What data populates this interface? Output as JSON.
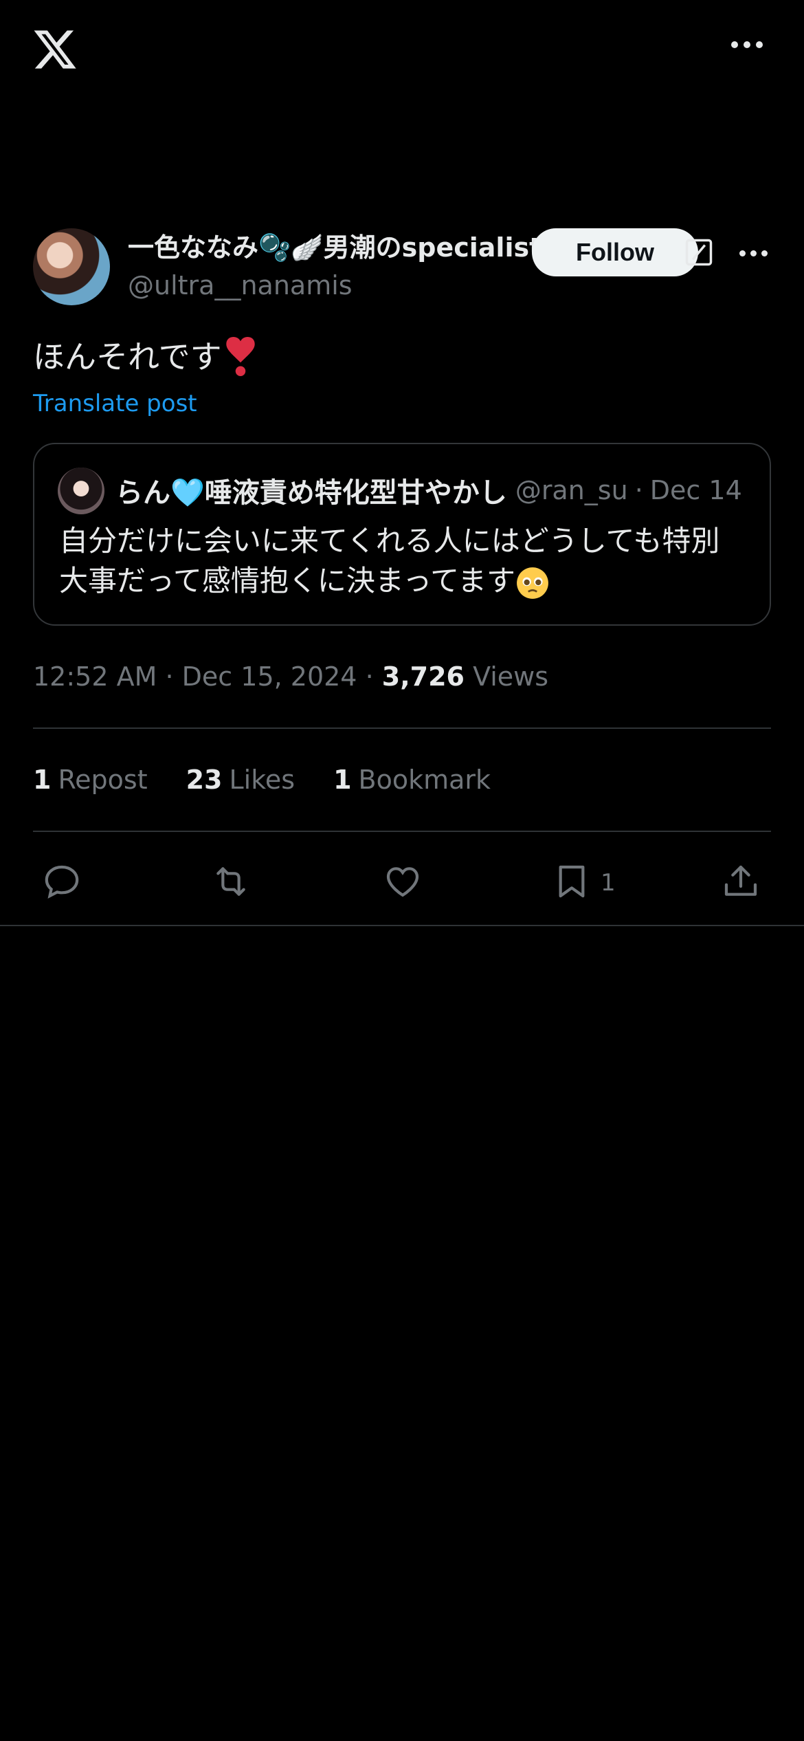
{
  "topbar": {
    "logo": "x-logo-icon",
    "more": "more-horizontal-icon"
  },
  "author": {
    "display_name": "一色ななみ🫧🪽男潮のspecialist",
    "handle": "@ultra__nanamis",
    "follow_label": "Follow"
  },
  "post": {
    "text": "ほんそれです",
    "emoji": "heart-exclamation-icon",
    "translate_label": "Translate post"
  },
  "quote": {
    "display_name": "らん🩵唾液責め特化型甘やかし",
    "handle": "@ran_su",
    "date_sep": "·",
    "date": "Dec 14",
    "text_line1": "自分だけに会いに来てくれる人にはどうしても特別",
    "text_line2": "大事だって感情抱くに決まってます",
    "emoji": "pleading-face-icon"
  },
  "meta": {
    "time": "12:52 AM",
    "sep1": "·",
    "date": "Dec 15, 2024",
    "sep2": "·",
    "views_count": "3,726",
    "views_label": "Views"
  },
  "stats": {
    "reposts_count": "1",
    "reposts_label": "Repost",
    "likes_count": "23",
    "likes_label": "Likes",
    "bookmarks_count": "1",
    "bookmarks_label": "Bookmark"
  },
  "actions": {
    "bookmark_count": "1"
  },
  "colors": {
    "background": "#000000",
    "text": "#e7e9ea",
    "muted": "#71767b",
    "link": "#1d9bf0",
    "divider": "#2f3336",
    "follow_bg": "#eff3f4"
  }
}
